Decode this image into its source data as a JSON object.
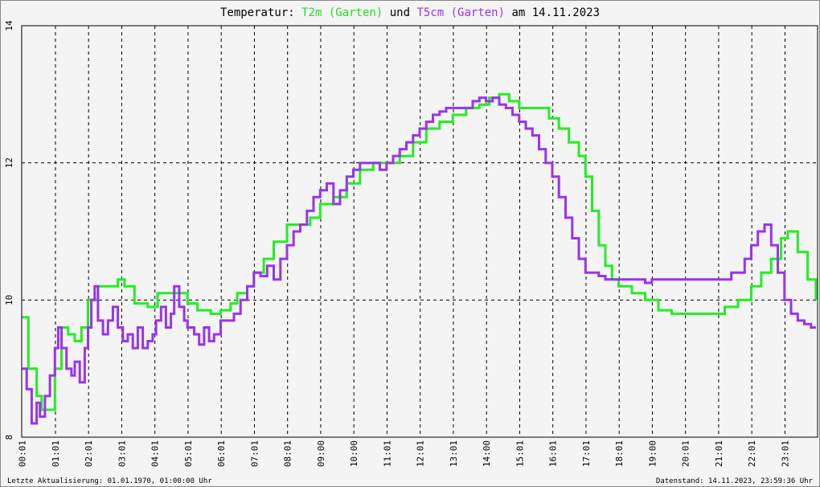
{
  "title": {
    "prefix": "Temperatur: ",
    "series1": "T2m (Garten)",
    "connector": " und ",
    "series2": "T5cm (Garten)",
    "suffix": " am 14.11.2023"
  },
  "footer": {
    "left": "Letzte Aktualisierung: 01.01.1970, 01:00:00 Uhr",
    "right": "Datenstand: 14.11.2023, 23:59:36 Uhr"
  },
  "colors": {
    "t2m": "#22ee22",
    "t5cm": "#9933ee",
    "grid": "#000000",
    "background": "#f4f4f4"
  },
  "chart_data": {
    "type": "line",
    "ylim": [
      8,
      14
    ],
    "xlim_hours": [
      0,
      24
    ],
    "yticks": [
      8,
      10,
      12,
      14
    ],
    "xticks": [
      "00:01",
      "01:01",
      "02:01",
      "03:01",
      "04:01",
      "05:01",
      "06:01",
      "07:01",
      "08:01",
      "09:00",
      "10:00",
      "11:01",
      "12:01",
      "13:01",
      "14:00",
      "15:01",
      "16:01",
      "17:01",
      "18:01",
      "19:00",
      "20:01",
      "21:01",
      "22:01",
      "23:01"
    ],
    "grid": true,
    "series": [
      {
        "name": "T2m (Garten)",
        "color": "#22ee22",
        "x": [
          0.0,
          0.2,
          0.45,
          0.6,
          0.9,
          1.0,
          1.2,
          1.4,
          1.6,
          1.8,
          2.0,
          2.3,
          2.6,
          2.9,
          3.1,
          3.4,
          3.8,
          4.1,
          4.5,
          5.0,
          5.3,
          5.7,
          6.0,
          6.3,
          6.5,
          6.8,
          7.0,
          7.3,
          7.6,
          8.0,
          8.4,
          8.7,
          9.0,
          9.4,
          9.8,
          10.2,
          10.6,
          11.0,
          11.4,
          11.8,
          12.2,
          12.6,
          13.0,
          13.4,
          13.8,
          14.1,
          14.4,
          14.7,
          15.0,
          15.3,
          15.6,
          15.9,
          16.2,
          16.5,
          16.8,
          17.0,
          17.2,
          17.4,
          17.6,
          17.8,
          18.0,
          18.4,
          18.8,
          19.2,
          19.6,
          20.0,
          20.4,
          20.8,
          21.2,
          21.6,
          22.0,
          22.3,
          22.6,
          22.9,
          23.1,
          23.4,
          23.7,
          23.95
        ],
        "y": [
          9.75,
          9.0,
          8.6,
          8.4,
          8.4,
          9.0,
          9.6,
          9.5,
          9.4,
          9.6,
          10.0,
          10.2,
          10.2,
          10.3,
          10.2,
          9.95,
          9.9,
          10.1,
          10.1,
          9.95,
          9.85,
          9.8,
          9.85,
          9.95,
          10.1,
          10.2,
          10.4,
          10.6,
          10.85,
          11.1,
          11.1,
          11.2,
          11.4,
          11.5,
          11.7,
          11.9,
          12.0,
          12.0,
          12.1,
          12.3,
          12.5,
          12.6,
          12.7,
          12.8,
          12.85,
          12.95,
          13.0,
          12.9,
          12.8,
          12.8,
          12.8,
          12.65,
          12.5,
          12.3,
          12.1,
          11.8,
          11.3,
          10.8,
          10.5,
          10.3,
          10.2,
          10.1,
          10.0,
          9.85,
          9.8,
          9.8,
          9.8,
          9.8,
          9.9,
          10.0,
          10.2,
          10.4,
          10.6,
          10.9,
          11.0,
          10.7,
          10.3,
          10.0
        ]
      },
      {
        "name": "T5cm (Garten)",
        "color": "#9933ee",
        "x": [
          0.0,
          0.15,
          0.3,
          0.45,
          0.55,
          0.7,
          0.85,
          1.0,
          1.1,
          1.2,
          1.35,
          1.5,
          1.6,
          1.75,
          1.9,
          2.0,
          2.1,
          2.2,
          2.3,
          2.45,
          2.6,
          2.75,
          2.9,
          3.05,
          3.2,
          3.35,
          3.5,
          3.65,
          3.8,
          3.95,
          4.05,
          4.2,
          4.35,
          4.5,
          4.6,
          4.75,
          4.9,
          5.0,
          5.2,
          5.35,
          5.5,
          5.65,
          5.8,
          6.0,
          6.2,
          6.4,
          6.6,
          6.8,
          7.0,
          7.2,
          7.4,
          7.6,
          7.8,
          8.0,
          8.2,
          8.4,
          8.6,
          8.8,
          9.0,
          9.2,
          9.4,
          9.6,
          9.8,
          10.0,
          10.2,
          10.4,
          10.6,
          10.8,
          11.0,
          11.2,
          11.4,
          11.6,
          11.8,
          12.0,
          12.2,
          12.4,
          12.6,
          12.8,
          13.0,
          13.2,
          13.4,
          13.6,
          13.8,
          14.0,
          14.2,
          14.4,
          14.6,
          14.8,
          15.0,
          15.2,
          15.4,
          15.6,
          15.8,
          16.0,
          16.2,
          16.4,
          16.6,
          16.8,
          17.0,
          17.2,
          17.4,
          17.6,
          17.8,
          18.0,
          18.2,
          18.4,
          18.6,
          18.8,
          19.0,
          19.4,
          19.8,
          20.0,
          20.2,
          20.6,
          21.0,
          21.4,
          21.8,
          22.0,
          22.2,
          22.4,
          22.6,
          22.8,
          23.0,
          23.2,
          23.4,
          23.6,
          23.8,
          23.95
        ],
        "y": [
          9.0,
          8.7,
          8.2,
          8.5,
          8.3,
          8.6,
          8.9,
          9.3,
          9.6,
          9.3,
          9.0,
          8.9,
          9.1,
          8.8,
          9.3,
          9.6,
          10.0,
          10.2,
          9.7,
          9.5,
          9.7,
          9.9,
          9.6,
          9.4,
          9.5,
          9.3,
          9.6,
          9.3,
          9.4,
          9.5,
          9.7,
          9.9,
          9.6,
          9.8,
          10.2,
          9.9,
          9.7,
          9.6,
          9.5,
          9.35,
          9.6,
          9.4,
          9.5,
          9.7,
          9.7,
          9.8,
          10.0,
          10.2,
          10.4,
          10.35,
          10.5,
          10.3,
          10.6,
          10.8,
          11.0,
          11.1,
          11.3,
          11.5,
          11.6,
          11.7,
          11.4,
          11.6,
          11.8,
          11.9,
          12.0,
          12.0,
          12.0,
          11.9,
          12.0,
          12.1,
          12.2,
          12.3,
          12.4,
          12.5,
          12.6,
          12.7,
          12.75,
          12.8,
          12.8,
          12.8,
          12.8,
          12.9,
          12.95,
          12.9,
          12.95,
          12.85,
          12.8,
          12.7,
          12.6,
          12.5,
          12.4,
          12.2,
          12.0,
          11.8,
          11.5,
          11.2,
          10.9,
          10.6,
          10.4,
          10.4,
          10.35,
          10.3,
          10.3,
          10.3,
          10.3,
          10.3,
          10.3,
          10.25,
          10.3,
          10.3,
          10.3,
          10.3,
          10.3,
          10.3,
          10.3,
          10.4,
          10.6,
          10.8,
          11.0,
          11.1,
          10.8,
          10.4,
          10.0,
          9.8,
          9.7,
          9.65,
          9.6,
          9.6
        ]
      }
    ]
  }
}
